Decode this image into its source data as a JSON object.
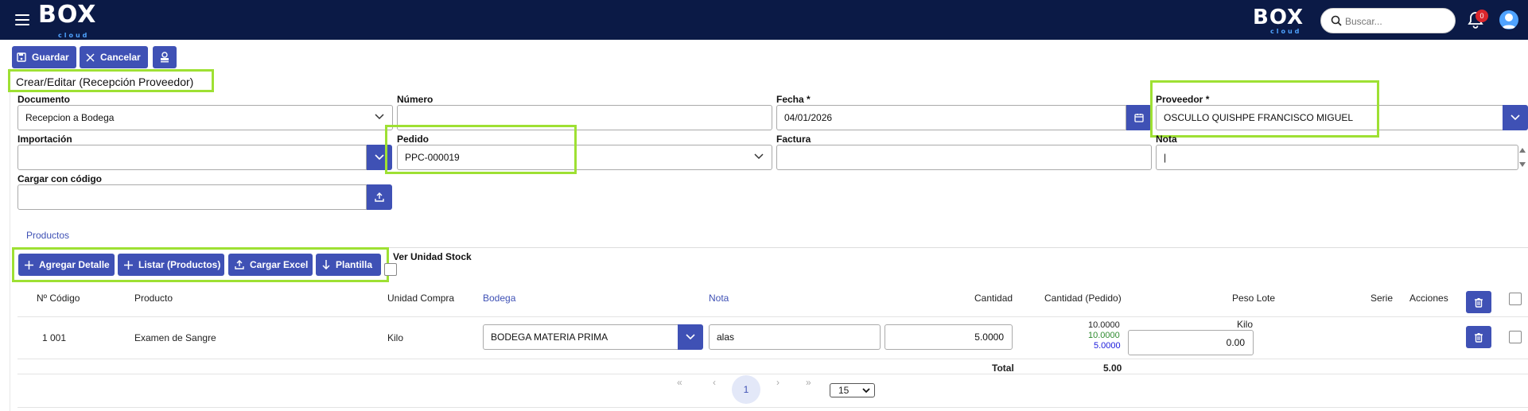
{
  "header": {
    "logo_main": "BOX",
    "logo_sub": "cloud",
    "search_placeholder": "Buscar...",
    "notifications_count": "0"
  },
  "toolbar": {
    "save_label": "Guardar",
    "cancel_label": "Cancelar"
  },
  "page_title": "Crear/Editar (Recepción Proveedor)",
  "form": {
    "documento_label": "Documento",
    "documento_value": "Recepcion a Bodega",
    "numero_label": "Número",
    "numero_value": "",
    "fecha_label": "Fecha *",
    "fecha_value": "04/01/2026",
    "proveedor_label": "Proveedor *",
    "proveedor_value": "OSCULLO QUISHPE FRANCISCO MIGUEL",
    "importacion_label": "Importación",
    "importacion_value": "",
    "pedido_label": "Pedido",
    "pedido_value": "PPC-000019",
    "factura_label": "Factura",
    "factura_value": "",
    "nota_label": "Nota",
    "nota_value": "|",
    "cargar_label": "Cargar con código",
    "cargar_value": ""
  },
  "tabs": {
    "productos": "Productos"
  },
  "detail_toolbar": {
    "agregar": "Agregar Detalle",
    "listar": "Listar (Productos)",
    "cargar_excel": "Cargar Excel",
    "plantilla": "Plantilla",
    "ver_unidad": "Ver Unidad Stock"
  },
  "table": {
    "headers": {
      "codigo": "Nº Código",
      "producto": "Producto",
      "unidad": "Unidad Compra",
      "bodega": "Bodega",
      "nota": "Nota",
      "cantidad": "Cantidad",
      "cantidad_pedido": "Cantidad (Pedido)",
      "peso": "Peso Lote",
      "serie": "Serie",
      "acciones": "Acciones"
    },
    "rows": [
      {
        "codigo": "1 001",
        "producto": "Examen de Sangre",
        "unidad": "Kilo",
        "bodega": "BODEGA MATERIA PRIMA",
        "nota": "alas",
        "cantidad": "5.0000",
        "ped1": "10.0000",
        "ped2": "10.0000",
        "ped3": "5.0000",
        "peso_unit": "Kilo",
        "peso": "0.00"
      }
    ],
    "total_label": "Total",
    "total_value": "5.00"
  },
  "pagination": {
    "current": "1",
    "page_size": "15"
  },
  "colors": {
    "primary": "#3f51b5",
    "header_bg": "#0b1a46",
    "highlight": "#9ee033",
    "green_text": "#2e8b2e",
    "blue_text": "#1a1adc"
  }
}
